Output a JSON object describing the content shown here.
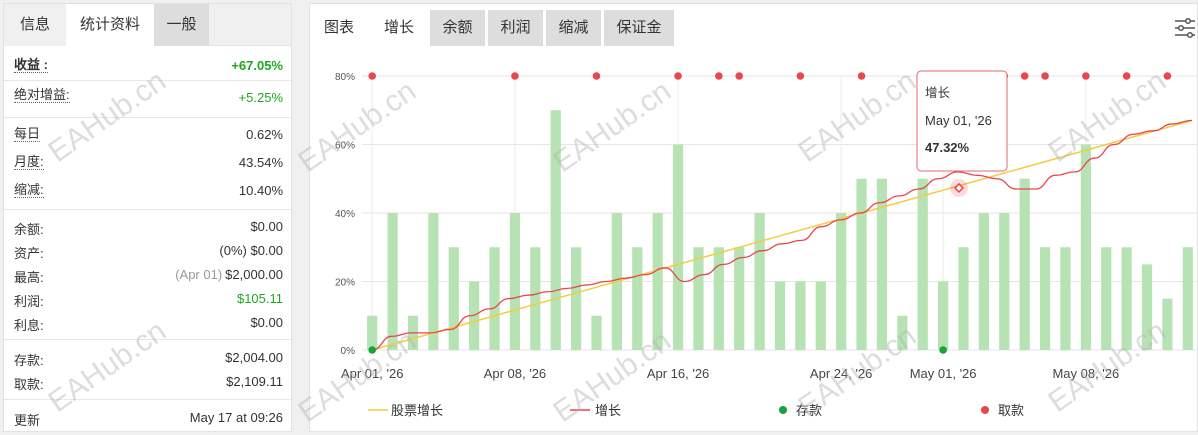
{
  "left_tabs": [
    "信息",
    "统计资料",
    "一般"
  ],
  "stats": {
    "gain_label": "收益 :",
    "gain_value": "+67.05%",
    "abs_label": "绝对增益:",
    "abs_value": "+5.25%",
    "daily_label": "每日",
    "daily_value": "0.62%",
    "monthly_label": "月度:",
    "monthly_value": "43.54%",
    "drawdown_label": "缩减:",
    "drawdown_value": "10.40%",
    "balance_label": "余额:",
    "balance_value": "$0.00",
    "equity_label": "资产:",
    "equity_value": "(0%) $0.00",
    "highest_label": "最高:",
    "highest_date": "(Apr 01)",
    "highest_value": "$2,000.00",
    "profit_label": "利润:",
    "profit_value": "$105.11",
    "interest_label": "利息:",
    "interest_value": "$0.00",
    "deposits_label": "存款:",
    "deposits_value": "$2,004.00",
    "withdrawals_label": "取款:",
    "withdrawals_value": "$2,109.11",
    "updated_label": "更新",
    "updated_value": "May 17 at 09:26"
  },
  "right_tabs": [
    "图表",
    "增长",
    "余额",
    "利润",
    "缩减",
    "保证金"
  ],
  "icons": {
    "filter": "sliders-icon"
  },
  "watermark": "EAHub.cn",
  "tooltip": {
    "title": "增长",
    "date": "May 01, '26",
    "value": "47.32%"
  },
  "chart_data": {
    "type": "bar+line",
    "y_ticks": [
      "0%",
      "20%",
      "40%",
      "60%",
      "80%"
    ],
    "ylim": [
      0,
      80
    ],
    "x_ticks": [
      "Apr 01, '26",
      "Apr 08, '26",
      "Apr 16, '26",
      "Apr 24, '26",
      "May 01, '26",
      "May 08, '26"
    ],
    "x_tick_index": [
      0,
      7,
      15,
      23,
      28,
      35
    ],
    "bars": [
      10,
      40,
      10,
      40,
      30,
      20,
      30,
      40,
      30,
      70,
      30,
      10,
      40,
      30,
      40,
      60,
      30,
      30,
      30,
      40,
      20,
      20,
      20,
      40,
      50,
      50,
      10,
      50,
      20,
      30,
      40,
      40,
      50,
      30,
      30,
      60,
      30,
      30,
      25,
      15,
      30
    ],
    "growth_line": [
      0,
      4,
      5,
      5,
      6,
      10,
      12,
      15,
      16,
      17,
      18,
      19,
      20,
      21,
      22,
      24,
      20,
      22,
      25,
      27,
      29,
      31,
      32,
      36,
      38,
      40,
      43,
      45,
      47,
      50,
      52,
      51,
      50,
      47,
      47,
      51,
      52,
      56,
      60,
      63,
      64,
      66,
      67.05
    ],
    "stock_line": {
      "start": 0,
      "end": 67
    },
    "deposits_index": [
      0,
      28
    ],
    "withdrawals_index": [
      0,
      7,
      11,
      15,
      17,
      18,
      21,
      24,
      27,
      30,
      31,
      32,
      33,
      35,
      37,
      39
    ],
    "legend": [
      "股票增长",
      "增长",
      "存款",
      "取款"
    ],
    "colors": {
      "bar": "#b7e2b3",
      "growth": "#e8474b",
      "stock": "#f3cc40",
      "deposit": "#18a33a",
      "withdrawal": "#e8474b"
    }
  }
}
